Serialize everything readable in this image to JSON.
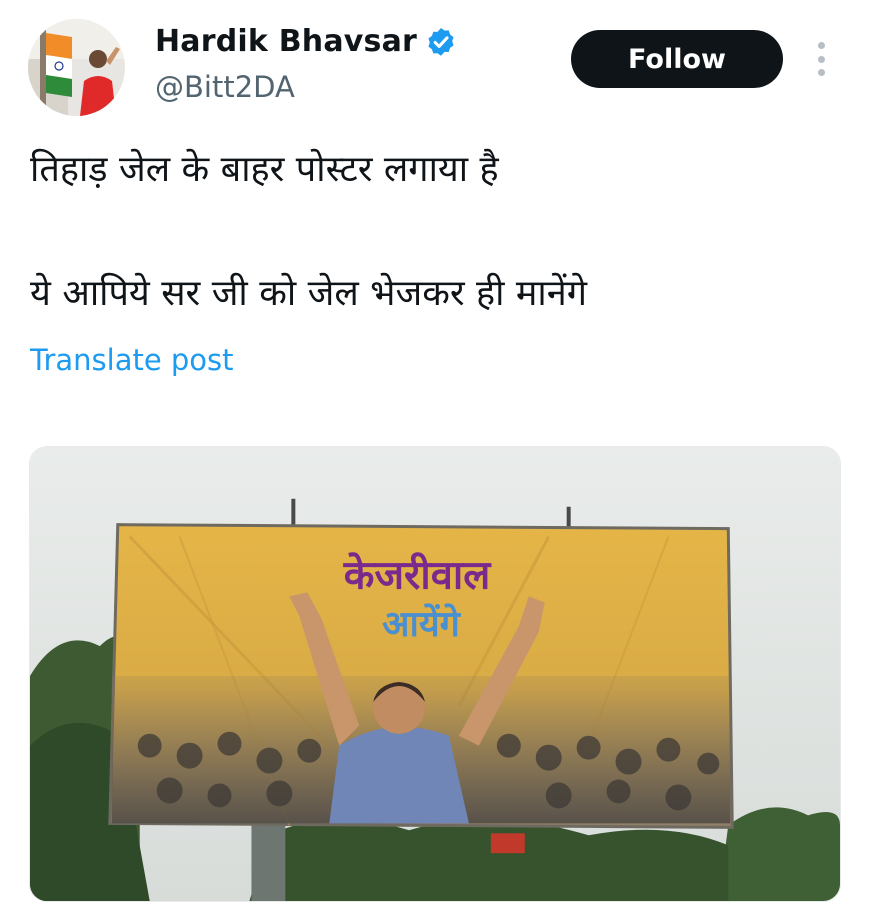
{
  "user": {
    "display_name": "Hardik Bhavsar",
    "handle": "@Bitt2DA",
    "verified": true,
    "avatar_icon": "profile-photo"
  },
  "actions": {
    "follow_label": "Follow",
    "more_icon": "vertical-ellipsis-icon"
  },
  "tweet": {
    "line1": "तिहाड़ जेल के बाहर पोस्टर लगाया है",
    "line2": "ये आपिये सर जी को जेल भेजकर ही मानेंगे",
    "translate_label": "Translate post"
  },
  "media": {
    "poster_line1": "केजरीवाल",
    "poster_line2": "आयेंगे"
  },
  "colors": {
    "accent": "#1d9bf0",
    "follow_bg": "#0f1419",
    "handle": "#536471",
    "verified": "#1d9bf0",
    "poster": "#e2b24a"
  }
}
